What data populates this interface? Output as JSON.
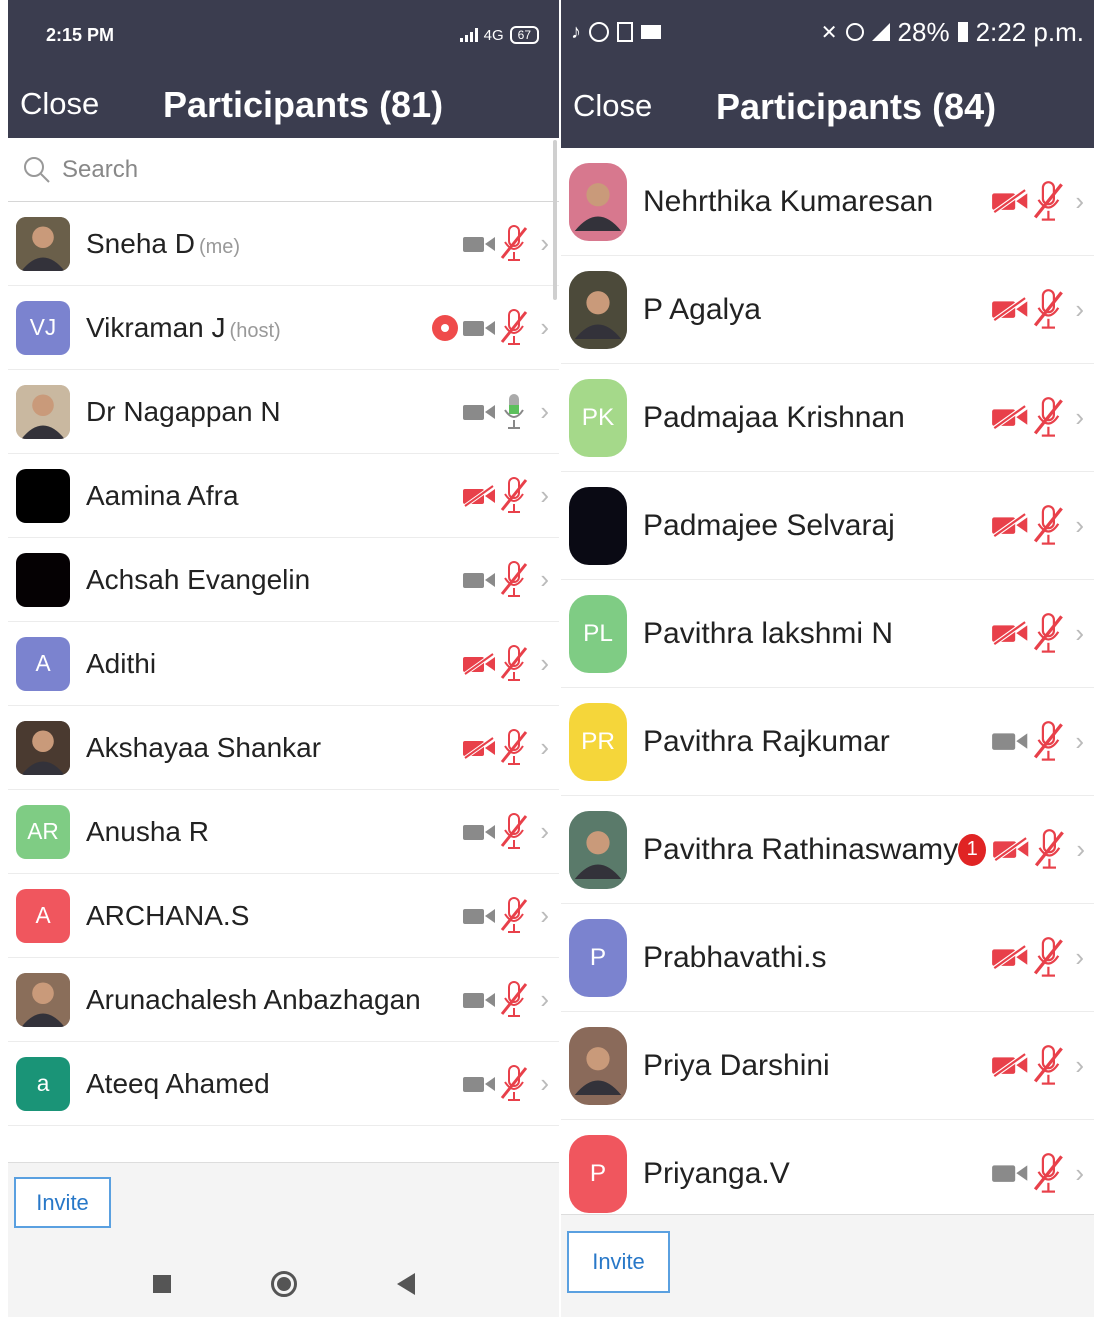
{
  "left": {
    "status": {
      "time": "2:15 PM",
      "network": "4G",
      "battery": "67"
    },
    "header": {
      "close_label": "Close",
      "title": "Participants (81)"
    },
    "search": {
      "placeholder": "Search"
    },
    "participants": [
      {
        "name": "Sneha D",
        "tag": "(me)",
        "avatar": "photo",
        "color": "#6a5f4a",
        "video": "off-gray",
        "audio": "muted",
        "recording": false
      },
      {
        "name": "Vikraman J",
        "tag": "(host)",
        "avatar": "VJ",
        "color": "#7b83cf",
        "video": "off-gray",
        "audio": "muted",
        "recording": true
      },
      {
        "name": "Dr Nagappan N",
        "tag": "",
        "avatar": "photo",
        "color": "#c9b8a0",
        "video": "off-gray",
        "audio": "on",
        "recording": false
      },
      {
        "name": "Aamina Afra",
        "tag": "",
        "avatar": "",
        "color": "#000000",
        "video": "off-red",
        "audio": "muted",
        "recording": false
      },
      {
        "name": "Achsah Evangelin",
        "tag": "",
        "avatar": "",
        "color": "#050103",
        "video": "off-gray",
        "audio": "muted",
        "recording": false
      },
      {
        "name": "Adithi",
        "tag": "",
        "avatar": "A",
        "color": "#7b83cf",
        "video": "off-red",
        "audio": "muted",
        "recording": false
      },
      {
        "name": "Akshayaa Shankar",
        "tag": "",
        "avatar": "photo",
        "color": "#4a3a30",
        "video": "off-red",
        "audio": "muted",
        "recording": false
      },
      {
        "name": "Anusha R",
        "tag": "",
        "avatar": "AR",
        "color": "#7fcc84",
        "video": "off-gray",
        "audio": "muted",
        "recording": false
      },
      {
        "name": "ARCHANA.S",
        "tag": "",
        "avatar": "A",
        "color": "#f0565e",
        "video": "off-gray",
        "audio": "muted",
        "recording": false
      },
      {
        "name": "Arunachalesh Anbazhagan",
        "tag": "",
        "avatar": "photo",
        "color": "#8a6e5a",
        "video": "off-gray",
        "audio": "muted",
        "recording": false
      },
      {
        "name": "Ateeq Ahamed",
        "tag": "",
        "avatar": "a",
        "color": "#1a9477",
        "video": "off-gray",
        "audio": "muted",
        "recording": false
      }
    ],
    "invite_label": "Invite"
  },
  "right": {
    "status": {
      "battery": "28%",
      "time": "2:22 p.m."
    },
    "header": {
      "close_label": "Close",
      "title": "Participants (84)"
    },
    "participants": [
      {
        "name": "Nehrthika Kumaresan",
        "avatar": "photo",
        "color": "#d7788e",
        "video": "off-red",
        "audio": "muted",
        "badge": ""
      },
      {
        "name": "P Agalya",
        "avatar": "photo",
        "color": "#4c4a3a",
        "video": "off-red",
        "audio": "muted",
        "badge": ""
      },
      {
        "name": "Padmajaa Krishnan",
        "avatar": "PK",
        "color": "#a5d98a",
        "video": "off-red",
        "audio": "muted",
        "badge": ""
      },
      {
        "name": "Padmajee Selvaraj",
        "avatar": "",
        "color": "#0a0a14",
        "video": "off-red",
        "audio": "muted",
        "badge": ""
      },
      {
        "name": "Pavithra lakshmi N",
        "avatar": "PL",
        "color": "#7fcc84",
        "video": "off-red",
        "audio": "muted",
        "badge": ""
      },
      {
        "name": "Pavithra Rajkumar",
        "avatar": "PR",
        "color": "#f5d63a",
        "video": "off-gray",
        "audio": "muted",
        "badge": ""
      },
      {
        "name": "Pavithra Rathinaswamy",
        "avatar": "photo",
        "color": "#5a7a6a",
        "video": "off-red",
        "audio": "muted",
        "badge": "1"
      },
      {
        "name": "Prabhavathi.s",
        "avatar": "P",
        "color": "#7b83cf",
        "video": "off-red",
        "audio": "muted",
        "badge": ""
      },
      {
        "name": "Priya Darshini",
        "avatar": "photo",
        "color": "#8a6a5a",
        "video": "off-red",
        "audio": "muted",
        "badge": ""
      },
      {
        "name": "Priyanga.V",
        "avatar": "P",
        "color": "#f0565e",
        "video": "off-gray",
        "audio": "muted",
        "badge": ""
      }
    ],
    "invite_label": "Invite"
  }
}
